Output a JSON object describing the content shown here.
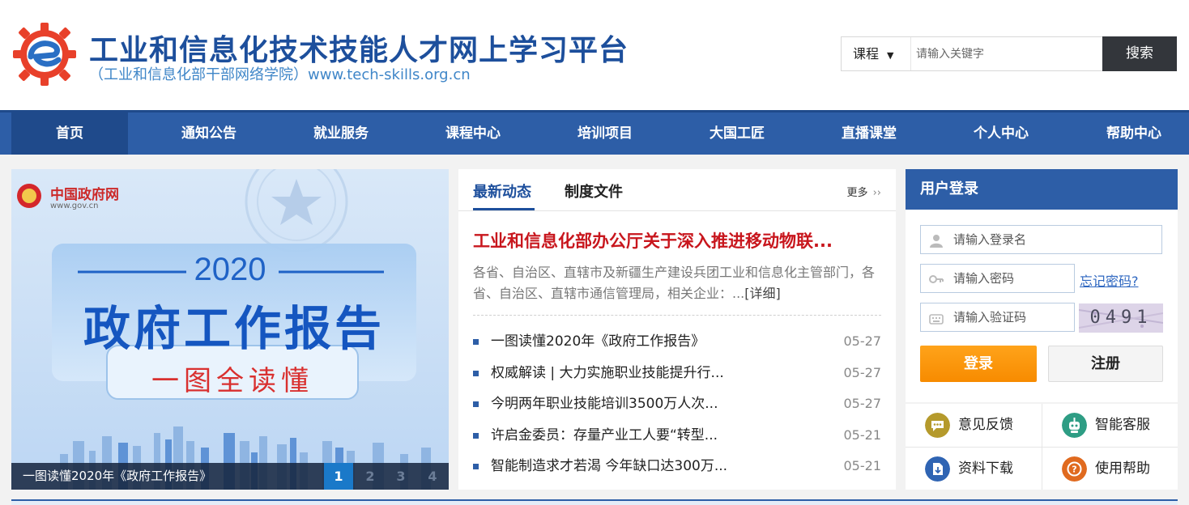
{
  "header": {
    "site_title": "工业和信息化技术技能人才网上学习平台",
    "site_subtitle": "（工业和信息化部干部网络学院）www.tech-skills.org.cn",
    "logo_icon": "gear-e-logo-icon"
  },
  "search": {
    "type_selected": "课程",
    "placeholder": "请输入关键字",
    "button_label": "搜索"
  },
  "nav": {
    "items": [
      {
        "label": "首页",
        "active": true
      },
      {
        "label": "通知公告"
      },
      {
        "label": "就业服务"
      },
      {
        "label": "课程中心"
      },
      {
        "label": "培训项目"
      },
      {
        "label": "大国工匠"
      },
      {
        "label": "直播课堂"
      },
      {
        "label": "个人中心"
      },
      {
        "label": "帮助中心"
      }
    ]
  },
  "banner": {
    "source_name": "中国政府网",
    "source_url": "www.gov.cn",
    "year": "2020",
    "headline": "政府工作报告",
    "sub_headline": "一图全读懂",
    "caption": "一图读懂2020年《政府工作报告》",
    "pages": [
      "1",
      "2",
      "3",
      "4"
    ],
    "active_page": "1"
  },
  "news": {
    "tabs": [
      "最新动态",
      "制度文件"
    ],
    "more_label": "更多",
    "headline": "工业和信息化部办公厅关于深入推进移动物联...",
    "summary": "各省、自治区、直辖市及新疆生产建设兵团工业和信息化主管部门，各省、自治区、直辖市通信管理局，相关企业：...",
    "detail_label": "[详细]",
    "items": [
      {
        "title": "一图读懂2020年《政府工作报告》",
        "date": "05-27"
      },
      {
        "title": "权威解读 | 大力实施职业技能提升行...",
        "date": "05-27"
      },
      {
        "title": "今明两年职业技能培训3500万人次...",
        "date": "05-27"
      },
      {
        "title": "许启金委员：存量产业工人要“转型...",
        "date": "05-21"
      },
      {
        "title": "智能制造求才若渴 今年缺口达300万...",
        "date": "05-21"
      }
    ]
  },
  "login": {
    "title": "用户登录",
    "username_placeholder": "请输入登录名",
    "password_placeholder": "请输入密码",
    "captcha_placeholder": "请输入验证码",
    "forgot_label": "忘记密码?",
    "captcha_value": "0491",
    "login_label": "登录",
    "register_label": "注册"
  },
  "quick_links": [
    {
      "label": "意见反馈",
      "icon": "feedback-icon",
      "color": "#b59a2c"
    },
    {
      "label": "智能客服",
      "icon": "robot-icon",
      "color": "#2e9d84"
    },
    {
      "label": "资料下载",
      "icon": "download-icon",
      "color": "#2f64b3"
    },
    {
      "label": "使用帮助",
      "icon": "help-icon",
      "color": "#e06a1f"
    }
  ],
  "colors": {
    "brand_blue": "#2d5ea7",
    "headline_red": "#c8161d",
    "login_orange": "#f78b00"
  }
}
